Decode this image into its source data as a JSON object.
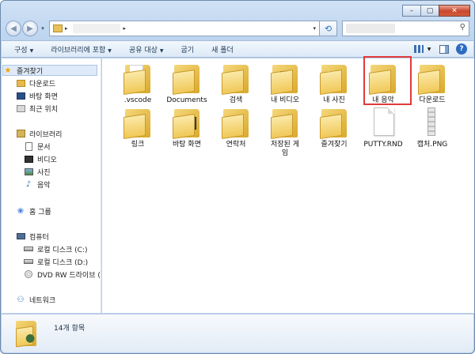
{
  "window": {
    "caption": {
      "minimize": "–",
      "maximize": "▢",
      "close": "✕"
    }
  },
  "address": {
    "arrow1": "▸",
    "arrow2": "▸",
    "dropdown": "▾",
    "refresh": "⟲",
    "search_icon": "⚲"
  },
  "toolbar": {
    "organize": "구성",
    "include_library": "라이브러리에 포함",
    "share": "공유 대상",
    "burn": "굽기",
    "new_folder": "새 폴더",
    "help": "?"
  },
  "nav": {
    "favorites": "즐겨찾기",
    "downloads": "다운로드",
    "desktop": "바탕 화면",
    "recent": "최근 위치",
    "libraries": "라이브러리",
    "documents": "문서",
    "videos": "비디오",
    "pictures": "사진",
    "music": "음악",
    "homegroup": "홈 그룹",
    "computer": "컴퓨터",
    "disk_c": "로컬 디스크 (C:)",
    "disk_d": "로컬 디스크 (D:)",
    "dvd": "DVD RW 드라이브 (",
    "network": "네트워크"
  },
  "items": [
    {
      "label": ".vscode",
      "kind": "folder",
      "overlay": "paper"
    },
    {
      "label": "Documents",
      "kind": "folder",
      "overlay": ""
    },
    {
      "label": "검색",
      "kind": "folder",
      "overlay": "search"
    },
    {
      "label": "내 비디오",
      "kind": "folder",
      "overlay": "film"
    },
    {
      "label": "내 사진",
      "kind": "folder",
      "overlay": "photo"
    },
    {
      "label": "내 음악",
      "kind": "folder",
      "overlay": "music"
    },
    {
      "label": "다운로드",
      "kind": "folder",
      "overlay": "download"
    },
    {
      "label": "링크",
      "kind": "folder",
      "overlay": "link"
    },
    {
      "label": "바탕 화면",
      "kind": "folder",
      "overlay": "desktop"
    },
    {
      "label": "연락처",
      "kind": "folder",
      "overlay": "contacts"
    },
    {
      "label": "저장된 게\n임",
      "kind": "folder",
      "overlay": "games"
    },
    {
      "label": "즐겨찾기",
      "kind": "folder",
      "overlay": "star"
    },
    {
      "label": "PUTTY.RND",
      "kind": "file",
      "overlay": ""
    },
    {
      "label": "캡처.PNG",
      "kind": "png",
      "overlay": ""
    }
  ],
  "details": {
    "count": "14개 항목"
  },
  "colors": {
    "highlight_border": "#e03a3a",
    "accent": "#2d73c4"
  }
}
